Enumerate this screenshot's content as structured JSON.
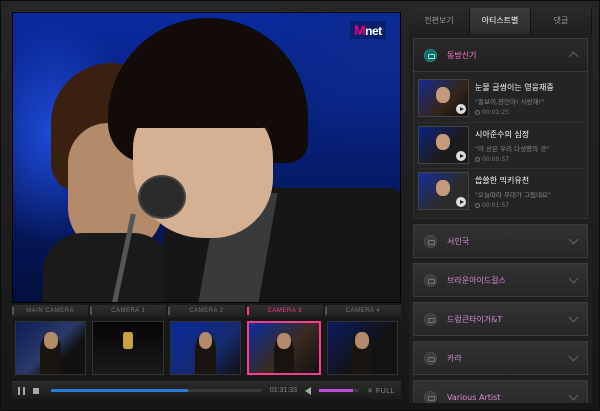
{
  "player": {
    "channel_logo": "Mnet",
    "cameras": [
      "MAIN CAMERA",
      "CAMERA 1",
      "CAMERA 2",
      "CAMERA 3",
      "CAMERA 4"
    ],
    "active_camera_index": 3,
    "controls": {
      "time": "01:31:33",
      "full_label": "FULL",
      "progress": 0.65,
      "volume": 0.85
    }
  },
  "panel": {
    "tabs": [
      {
        "label": "전편보기",
        "active": false
      },
      {
        "label": "아티스트별",
        "active": true
      },
      {
        "label": "댓글",
        "active": false
      }
    ],
    "artists": [
      {
        "name": "동방신기",
        "open": true,
        "videos": [
          {
            "title": "눈물 글썽이는 영웅재중",
            "subtitle": "\"홍보이,쟝인아! 사랑해!\"",
            "duration": "00:01:25"
          },
          {
            "title": "시아준수의 심정",
            "subtitle": "\"이 상은 우리 다섯명의 것\"",
            "duration": "00:00:57"
          },
          {
            "title": "씁쓸한 믹키유천",
            "subtitle": "\"오늘따라 무대가 그립네요\"",
            "duration": "00:01:57"
          }
        ]
      },
      {
        "name": "서인국",
        "open": false
      },
      {
        "name": "브라운아이드걸스",
        "open": false
      },
      {
        "name": "드렁큰타이거&T",
        "open": false
      },
      {
        "name": "카라",
        "open": false
      },
      {
        "name": "Various Artist",
        "open": false
      }
    ]
  }
}
